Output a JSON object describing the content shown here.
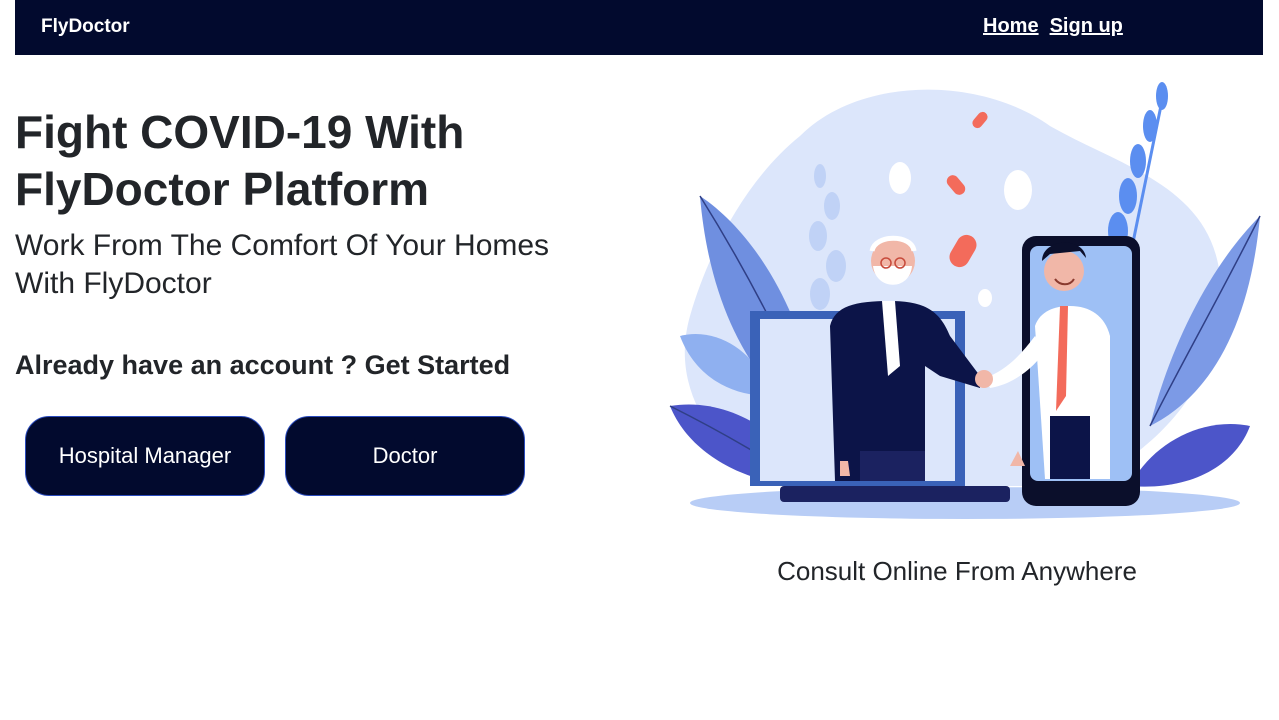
{
  "nav": {
    "brand": "FlyDoctor",
    "links": [
      "Home",
      "Sign up"
    ]
  },
  "hero": {
    "title": "Fight COVID-19 With FlyDoctor Platform",
    "subtitle": "Work From The Comfort Of Your Homes With FlyDoctor",
    "cta": "Already have an account ? Get Started"
  },
  "buttons": {
    "hospital_manager": "Hospital Manager",
    "doctor": "Doctor"
  },
  "illustration": {
    "caption": "Consult Online From Anywhere"
  },
  "colors": {
    "navbar": "#020a2e",
    "button": "#020a2e",
    "accent_blue": "#5b8ef0",
    "text": "#222529"
  }
}
